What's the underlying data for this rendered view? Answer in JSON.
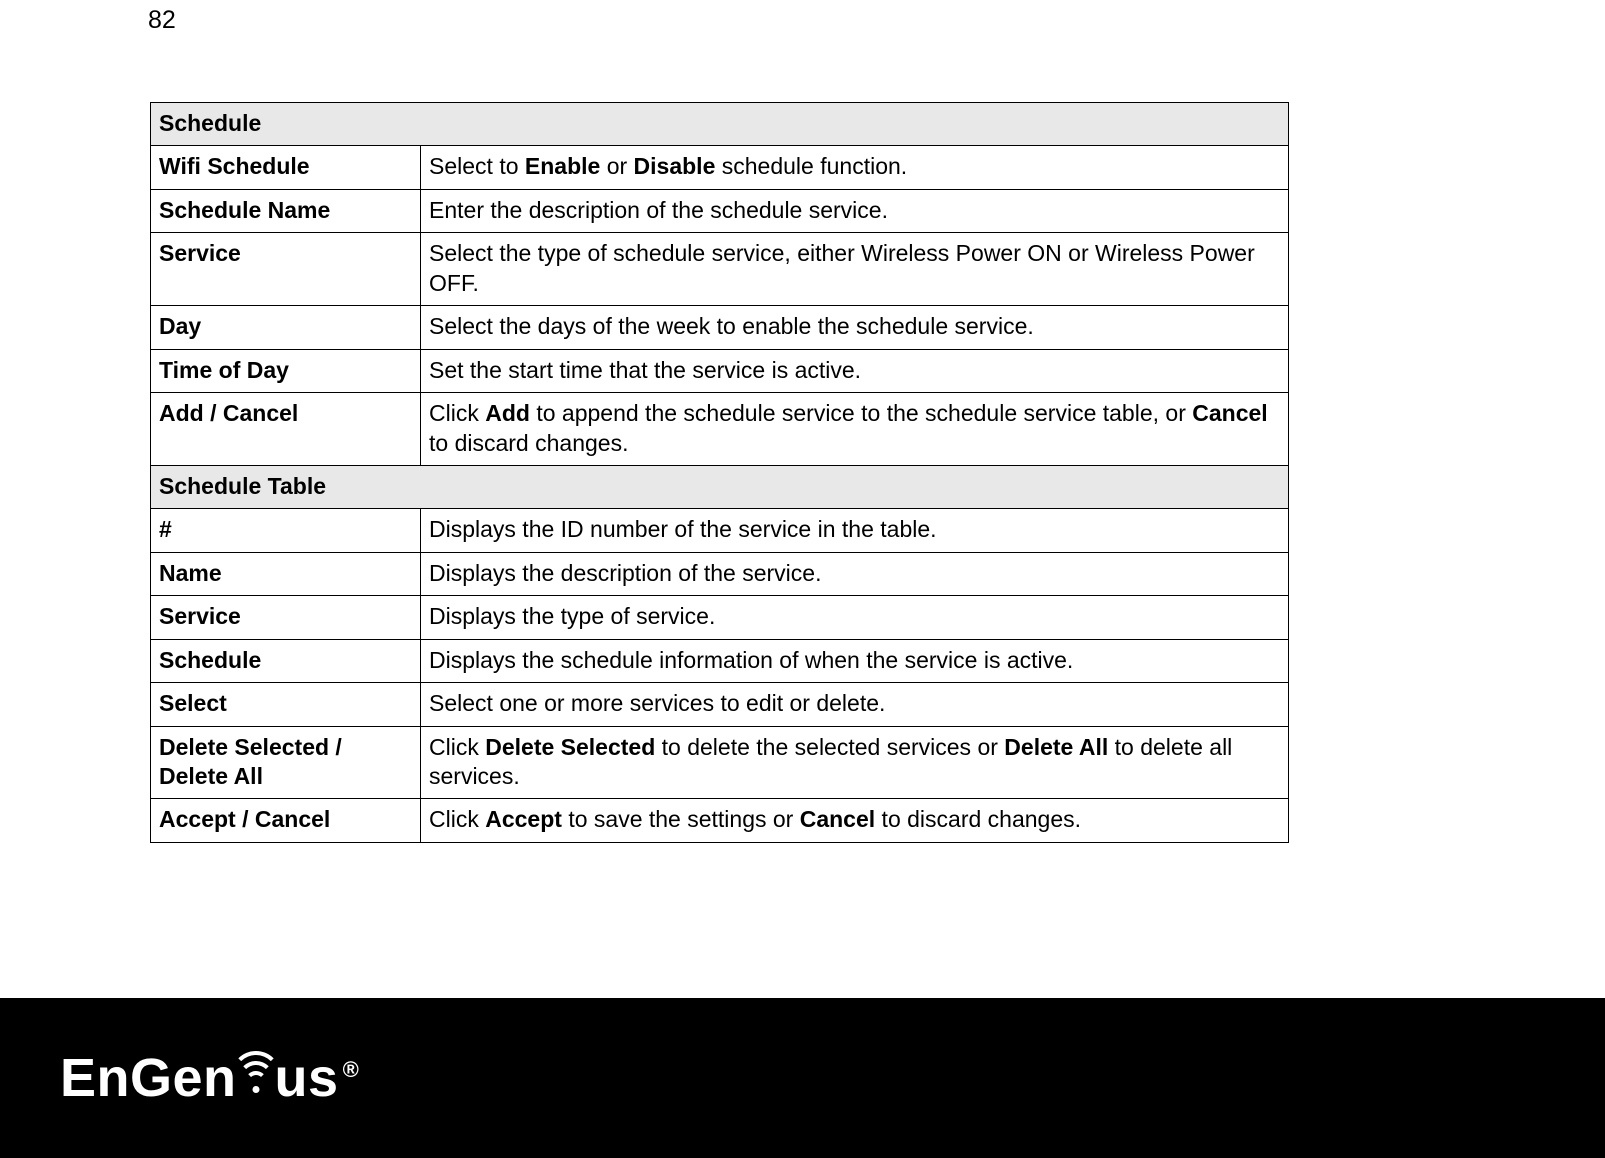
{
  "page_number": "82",
  "sections": [
    {
      "header": "Schedule",
      "rows": [
        {
          "label": "Wifi Schedule",
          "desc_html": "Select to <b>Enable</b> or <b>Disable</b> schedule function."
        },
        {
          "label": "Schedule Name",
          "desc_html": "Enter the description of the schedule service."
        },
        {
          "label": "Service",
          "desc_html": "Select the type of schedule service, either Wireless Power ON or Wireless Power OFF."
        },
        {
          "label": "Day",
          "desc_html": "Select the days of the week to enable the schedule service."
        },
        {
          "label": "Time of Day",
          "desc_html": "Set the start time that the service is active."
        },
        {
          "label": "Add / Cancel",
          "desc_html": "Click <b>Add</b> to append the schedule service to the schedule service table, or <b>Cancel</b> to discard changes."
        }
      ]
    },
    {
      "header": "Schedule Table",
      "rows": [
        {
          "label": "#",
          "desc_html": "Displays the ID number of the service in the table."
        },
        {
          "label": "Name",
          "desc_html": "Displays the description of the service."
        },
        {
          "label": "Service",
          "desc_html": "Displays the type of service."
        },
        {
          "label": "Schedule",
          "desc_html": "Displays the schedule information of when the service is active."
        },
        {
          "label": "Select",
          "desc_html": "Select one or more services to edit or delete."
        },
        {
          "label": "Delete Selected / Delete All",
          "desc_html": "Click <b>Delete Selected</b> to delete the selected services or <b>Delete All</b> to delete all services."
        },
        {
          "label": "Accept / Cancel",
          "desc_html": "Click <b>Accept</b> to save the settings or <b>Cancel</b> to discard changes."
        }
      ]
    }
  ],
  "logo": {
    "part1": "EnGen",
    "part2": "us",
    "registered": "®",
    "icon_name": "wifi-icon"
  }
}
